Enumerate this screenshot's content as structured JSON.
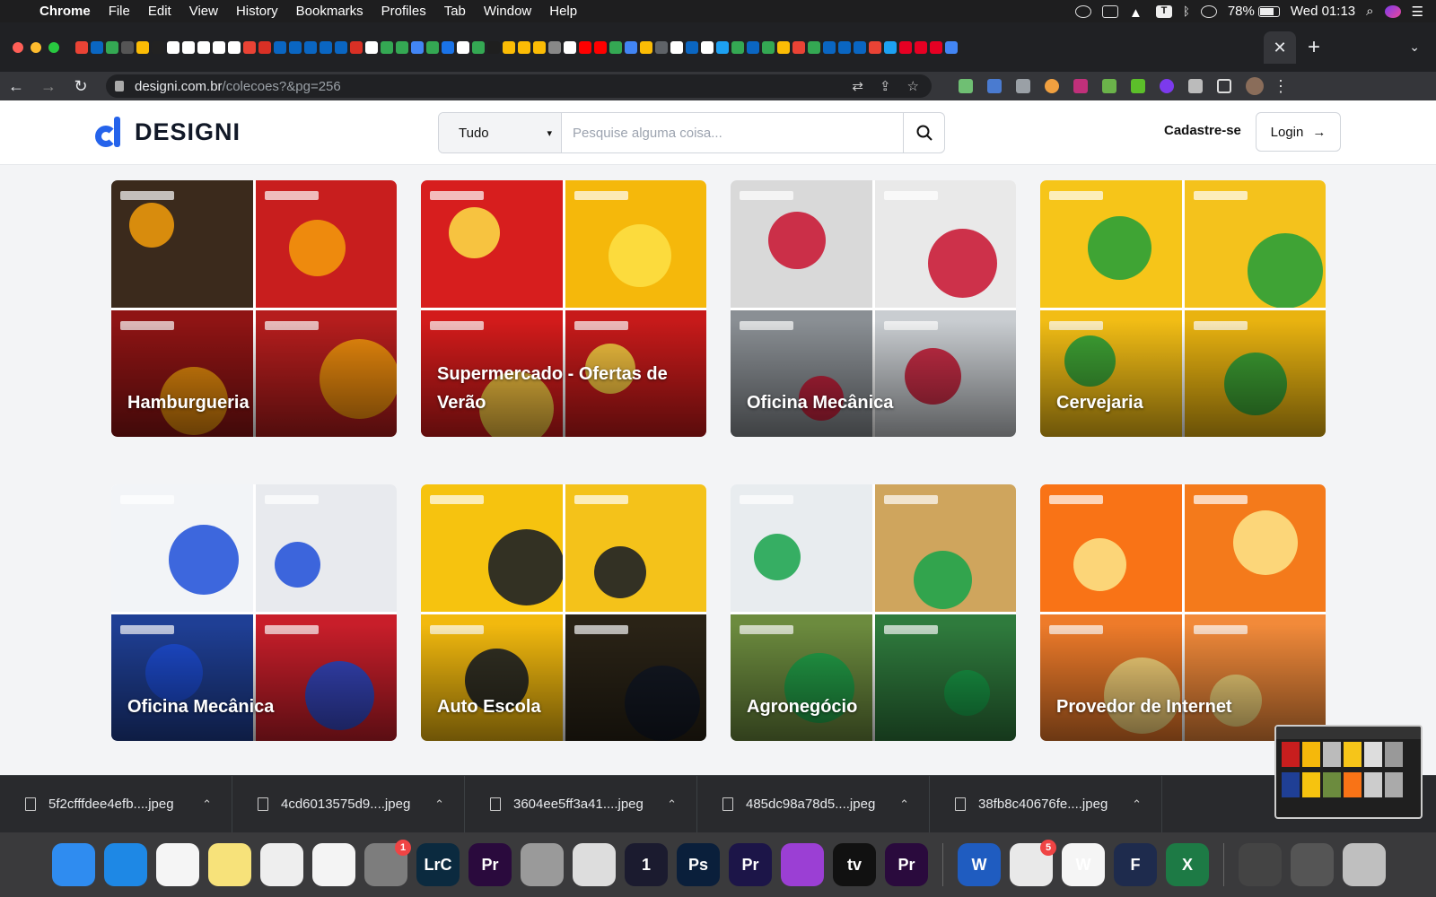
{
  "menubar": {
    "app_name": "Chrome",
    "menus": [
      "File",
      "Edit",
      "View",
      "History",
      "Bookmarks",
      "Profiles",
      "Tab",
      "Window",
      "Help"
    ],
    "battery": "78%",
    "clock": "Wed 01:13",
    "status_icons": [
      "creative-cloud-icon",
      "display-icon",
      "mountain-icon",
      "typora-icon",
      "bluetooth-icon",
      "wifi-icon"
    ]
  },
  "browser": {
    "url_host": "designi.com.br",
    "url_path": "/colecoes?&pg=256",
    "tab_close": "✕",
    "new_tab": "+"
  },
  "site": {
    "logo_text": "DESIGNI",
    "search": {
      "category": "Tudo",
      "placeholder": "Pesquise alguma coisa..."
    },
    "signup_label": "Cadastre-se",
    "login_label": "Login"
  },
  "collections": [
    {
      "title": "Hamburgueria",
      "colors": [
        "#3b2a1c",
        "#c81e1e",
        "#8f1414",
        "#b51d1d"
      ],
      "accent": "#f59e0b"
    },
    {
      "title": "Supermercado - Ofertas de Verão",
      "colors": [
        "#d71e1e",
        "#f5b80b",
        "#d31b1b",
        "#c71a1a"
      ],
      "accent": "#fde047"
    },
    {
      "title": "Oficina Mecânica",
      "colors": [
        "#d9d9d9",
        "#e9e9e9",
        "#8a8f94",
        "#c9cdd1"
      ],
      "accent": "#c8102e"
    },
    {
      "title": "Cervejaria",
      "colors": [
        "#f6c519",
        "#f4c21c",
        "#f2bd15",
        "#e9b310"
      ],
      "accent": "#1f9d3a"
    },
    {
      "title": "Oficina Mecânica",
      "colors": [
        "#f2f4f7",
        "#e8eaee",
        "#1f3f95",
        "#c81e2a"
      ],
      "accent": "#1d4ed8"
    },
    {
      "title": "Auto Escola",
      "colors": [
        "#f6c30f",
        "#f4c21a",
        "#f2b90e",
        "#2a2316"
      ],
      "accent": "#111827"
    },
    {
      "title": "Agronegócio",
      "colors": [
        "#e8ecef",
        "#cfa55d",
        "#6c8b3e",
        "#2f7b3d"
      ],
      "accent": "#16a34a"
    },
    {
      "title": "Provedor de Internet",
      "colors": [
        "#f97316",
        "#f47a1b",
        "#ee7b2a",
        "#f28a3a"
      ],
      "accent": "#fde68a"
    }
  ],
  "downloads": [
    {
      "name": "5f2cfffdee4efb....jpeg"
    },
    {
      "name": "4cd6013575d9....jpeg"
    },
    {
      "name": "3604ee5ff3a41....jpeg"
    },
    {
      "name": "485dc98a78d5....jpeg"
    },
    {
      "name": "38fb8c40676fe....jpeg"
    }
  ],
  "dock": [
    {
      "name": "finder",
      "label": "",
      "color": "#2f8cf0"
    },
    {
      "name": "safari",
      "label": "",
      "color": "#1e88e5"
    },
    {
      "name": "chrome",
      "label": "",
      "color": "#f5f5f5"
    },
    {
      "name": "notes",
      "label": "",
      "color": "#f7e27a"
    },
    {
      "name": "textedit",
      "label": "",
      "color": "#eeeeee"
    },
    {
      "name": "photos",
      "label": "",
      "color": "#f4f4f4"
    },
    {
      "name": "system-preferences",
      "label": "",
      "color": "#7d7d7d",
      "badge": "1"
    },
    {
      "name": "lightroom-classic",
      "label": "LrC",
      "color": "#0b2a3f"
    },
    {
      "name": "premiere-pro",
      "label": "Pr",
      "color": "#2a0a3d"
    },
    {
      "name": "no-entry",
      "label": "",
      "color": "#9a9a9a"
    },
    {
      "name": "preview",
      "label": "",
      "color": "#dddddd"
    },
    {
      "name": "1password",
      "label": "1",
      "color": "#1b1b2f"
    },
    {
      "name": "photoshop",
      "label": "Ps",
      "color": "#0a1f3b"
    },
    {
      "name": "premiere-rush",
      "label": "Pr",
      "color": "#1c1548"
    },
    {
      "name": "podcasts",
      "label": "",
      "color": "#9b3fd4"
    },
    {
      "name": "apple-tv",
      "label": "tv",
      "color": "#111111"
    },
    {
      "name": "premiere-pro-2",
      "label": "Pr",
      "color": "#2a0a3d"
    },
    {
      "name": "word",
      "label": "W",
      "color": "#1f5cc0"
    },
    {
      "name": "office",
      "label": "",
      "color": "#e9e9e9",
      "badge": "5"
    },
    {
      "name": "webex",
      "label": "W",
      "color": "#f5f5f5"
    },
    {
      "name": "flow",
      "label": "F",
      "color": "#1e2b4d"
    },
    {
      "name": "excel",
      "label": "X",
      "color": "#1d7a45"
    },
    {
      "name": "screenshots-stack",
      "label": "",
      "color": "#444444"
    },
    {
      "name": "downloads-stack",
      "label": "",
      "color": "#555555"
    },
    {
      "name": "trash",
      "label": "",
      "color": "#bfbfbf"
    }
  ]
}
